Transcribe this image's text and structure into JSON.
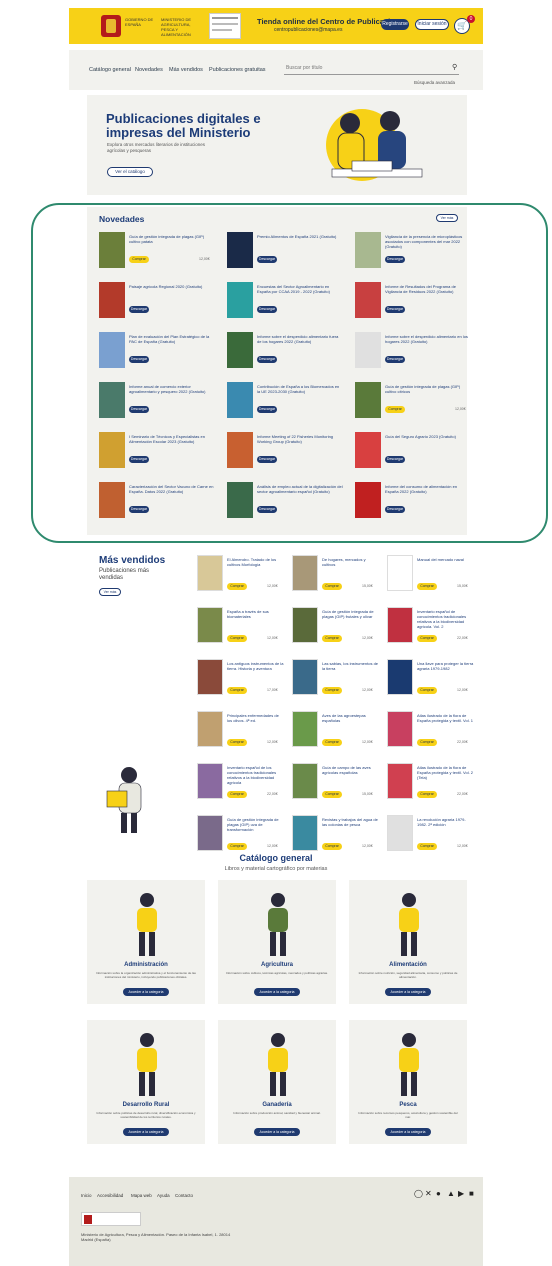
{
  "header": {
    "gov_text": "GOBIERNO DE ESPAÑA",
    "ministry_text": "MINISTERIO DE AGRICULTURA, PESCA Y ALIMENTACIÓN",
    "store_title": "Tienda online del Centro de Publicaciones",
    "store_sub": "centropublicaciones@mapa.es",
    "register_label": "Registrarse",
    "login_label": "Iniciar sesión",
    "cart_count": "0"
  },
  "nav": {
    "items": [
      "Catálogo general",
      "Novedades",
      "Más vendidos",
      "Publicaciones gratuitas"
    ],
    "search_placeholder": "Buscar por título",
    "advanced_search": "Búsqueda avanzada"
  },
  "hero": {
    "title": "Publicaciones digitales e impresas del Ministerio",
    "desc": "Explora otros mercados literarios de instituciones agrícolas y pesqueras",
    "button": "Ver el catálogo"
  },
  "novedades": {
    "title": "Novedades",
    "more": "Ver más",
    "items": [
      {
        "title": "Guía de gestión integrada de plagas (GIP) cultivo patata",
        "action": "Comprar",
        "price": "12,00€"
      },
      {
        "title": "Premio Alimentos de España 2021 (Gratuito)",
        "action": "Descargar",
        "price": ""
      },
      {
        "title": "Vigilancia de la presencia de microplásticos asociados con componentes del mar 2022 (Gratuito)",
        "action": "Descargar",
        "price": ""
      },
      {
        "title": "Paisaje agrícola Regional 2020 (Gratuito)",
        "action": "Descargar",
        "price": ""
      },
      {
        "title": "Encuestas del Sector Agroalimentario en España por CCAA 2019 - 2022 (Gratuito)",
        "action": "Descargar",
        "price": ""
      },
      {
        "title": "Informe de Resultados del Programa de Vigilancia de Residuos 2022 (Gratuito)",
        "action": "Descargar",
        "price": ""
      },
      {
        "title": "Plan de evaluación del Plan Estratégico de la PAC de España (Gratuito)",
        "action": "Descargar",
        "price": ""
      },
      {
        "title": "Informe sobre el desperdicio alimentario fuera de los hogares 2022 (Gratuito)",
        "action": "Descargar",
        "price": ""
      },
      {
        "title": "Informe sobre el desperdicio alimentario en los hogares 2022 (Gratuito)",
        "action": "Descargar",
        "price": ""
      },
      {
        "title": "Informe anual de comercio exterior agroalimentario y pesquero 2022 (Gratuito)",
        "action": "Descargar",
        "price": ""
      },
      {
        "title": "Contribución de España a los Biomercados en la UE 2023-2030 (Gratuito)",
        "action": "Descargar",
        "price": ""
      },
      {
        "title": "Guía de gestión integrada de plagas (GIP) cultivo cítricos",
        "action": "Comprar",
        "price": "12,00€"
      },
      {
        "title": "I Seminario de Técnicos y Especialistas en Alimentación Escolar 2023 (Gratuito)",
        "action": "Descargar",
        "price": ""
      },
      {
        "title": "Informe Meeting of 22 Fisheries Monitoring Working Group (Gratuito)",
        "action": "Descargar",
        "price": ""
      },
      {
        "title": "Guía del Seguro Agrario 2023 (Gratuito)",
        "action": "Descargar",
        "price": ""
      },
      {
        "title": "Caracterización del Sector Vacuno de Carne en España. Datos 2022 (Gratuito)",
        "action": "Descargar",
        "price": ""
      },
      {
        "title": "Análisis de empleo actual de la digitalización del sector agroalimentario español (Gratuito)",
        "action": "Descargar",
        "price": ""
      },
      {
        "title": "Informe del consumo de alimentación en España 2022 (Gratuito)",
        "action": "Descargar",
        "price": ""
      }
    ]
  },
  "mas_vendidos": {
    "title": "Más vendidos",
    "sub": "Publicaciones más vendidas",
    "more": "Ver más",
    "items": [
      {
        "title": "El Almendro. Tratado de los cultivos Morfología",
        "action": "Comprar",
        "price": "12,00€"
      },
      {
        "title": "De hogares, mercados y cultivos",
        "action": "Comprar",
        "price": "15,00€"
      },
      {
        "title": "Manual del mercado naval",
        "action": "Comprar",
        "price": "15,00€"
      },
      {
        "title": "España a través de sus biomateriales",
        "action": "Comprar",
        "price": "12,00€"
      },
      {
        "title": "Guía de gestión integrada de plagas (GIP) frutales y olivar",
        "action": "Comprar",
        "price": "12,00€"
      },
      {
        "title": "Inventario español de conocimientos tradicionales relativos a la biodiversidad agrícola. Vol. 2",
        "action": "Comprar",
        "price": "22,00€"
      },
      {
        "title": "Los antiguos instrumentos de la tierra. Historia y aventura",
        "action": "Comprar",
        "price": "17,00€"
      },
      {
        "title": "Las sabias, los instrumentos de la tierra",
        "action": "Comprar",
        "price": "12,00€"
      },
      {
        "title": "Una llave para proteger la tierra agraria 1979-1982",
        "action": "Comprar",
        "price": "12,00€"
      },
      {
        "title": "Principales enfermedades de los olivos. 4ª ed.",
        "action": "Comprar",
        "price": "12,00€"
      },
      {
        "title": "Aves de las agroestepas españolas",
        "action": "Comprar",
        "price": "12,00€"
      },
      {
        "title": "Atlas ilustrado de la flora de España protegida y textil. Vol. 1",
        "action": "Comprar",
        "price": "22,00€"
      },
      {
        "title": "Inventario español de los conocimientos tradicionales relativos a la biodiversidad agrícola",
        "action": "Comprar",
        "price": "22,00€"
      },
      {
        "title": "Guía de campo de las aves agrícolas españolas",
        "action": "Comprar",
        "price": "15,00€"
      },
      {
        "title": "Atlas ilustrado de la flora de España protegida y textil. Vol. 2 (Tela)",
        "action": "Comprar",
        "price": "22,00€"
      },
      {
        "title": "Guía de gestión integrada de plagas (GIP) uva de transformación",
        "action": "Comprar",
        "price": "12,00€"
      },
      {
        "title": "Revistas y trabajos del agua de las colonias de pesca",
        "action": "Comprar",
        "price": "12,00€"
      },
      {
        "title": "La revolución agraria 1979-1982. 2ª edición",
        "action": "Comprar",
        "price": "12,00€"
      }
    ]
  },
  "catalogo": {
    "title": "Catálogo general",
    "sub": "Libros y material cartográfico por materias",
    "items": [
      {
        "title": "Administración",
        "desc": "Información sobre la organización administrativa y el funcionamiento de las instituciones del ministerio, incluyendo publicaciones oficiales.",
        "button": "Acceder a la categoría"
      },
      {
        "title": "Agricultura",
        "desc": "Información sobre cultivos, técnicas agrícolas, mercados y políticas agrarias.",
        "button": "Acceder a la categoría"
      },
      {
        "title": "Alimentación",
        "desc": "Información sobre nutrición, seguridad alimentaria, consumo y políticas de alimentación.",
        "button": "Acceder a la categoría"
      },
      {
        "title": "Desarrollo Rural",
        "desc": "Información sobre políticas de desarrollo rural, diversificación económica y sostenibilidad de los territorios rurales.",
        "button": "Acceder a la categoría"
      },
      {
        "title": "Ganadería",
        "desc": "Información sobre producción animal, sanidad y bienestar animal.",
        "button": "Acceder a la categoría"
      },
      {
        "title": "Pesca",
        "desc": "Información sobre recursos pesqueros, acuicultura y gestión sostenible del mar.",
        "button": "Acceder a la categoría"
      }
    ]
  },
  "footer": {
    "links": [
      "Inicio",
      "Accesibilidad",
      "Mapa web",
      "Ayuda",
      "Contacto"
    ],
    "social": [
      "instagram-icon",
      "x-icon",
      "facebook-icon",
      "telegram-icon",
      "youtube-icon",
      "linkedin-icon"
    ],
    "address": "Ministerio de Agricultura, Pesca y Alimentación. Paseo de la Infanta Isabel, 1. 28014 Madrid (España)"
  },
  "colors": {
    "accent": "#f7d117",
    "brand": "#1f3a70",
    "frame": "#2f8a6e"
  }
}
